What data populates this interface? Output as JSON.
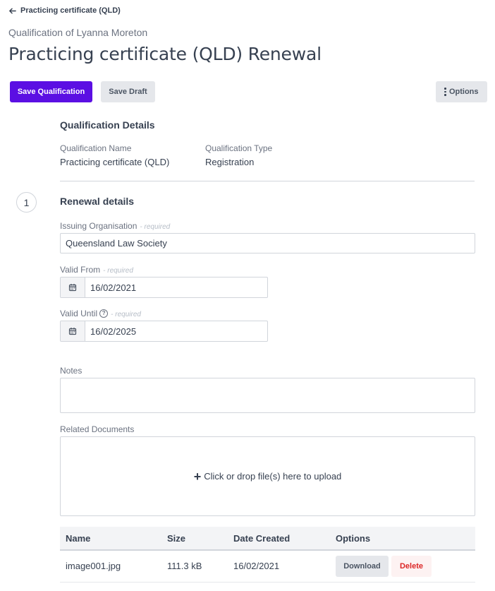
{
  "breadcrumb": {
    "back_label": "Practicing certificate (QLD)"
  },
  "header": {
    "subtitle": "Qualification of Lyanna Moreton",
    "title": "Practicing certificate (QLD) Renewal"
  },
  "toolbar": {
    "save_label": "Save Qualification",
    "draft_label": "Save Draft",
    "options_label": "Options"
  },
  "details": {
    "section_title": "Qualification Details",
    "name_label": "Qualification Name",
    "name_value": "Practicing certificate (QLD)",
    "type_label": "Qualification Type",
    "type_value": "Registration"
  },
  "renewal": {
    "step_number": "1",
    "section_title": "Renewal details",
    "required_text": "- required",
    "issuing_label": "Issuing Organisation",
    "issuing_value": "Queensland Law Society",
    "valid_from_label": "Valid From",
    "valid_from_value": "16/02/2021",
    "valid_until_label": "Valid Until",
    "valid_until_value": "16/02/2025",
    "notes_label": "Notes",
    "notes_value": ""
  },
  "documents": {
    "label": "Related Documents",
    "upload_text": "Click or drop file(s) here to upload",
    "columns": [
      "Name",
      "Size",
      "Date Created",
      "Options"
    ],
    "rows": [
      {
        "name": "image001.jpg",
        "size": "111.3 kB",
        "date": "16/02/2021",
        "download_label": "Download",
        "delete_label": "Delete"
      }
    ]
  }
}
